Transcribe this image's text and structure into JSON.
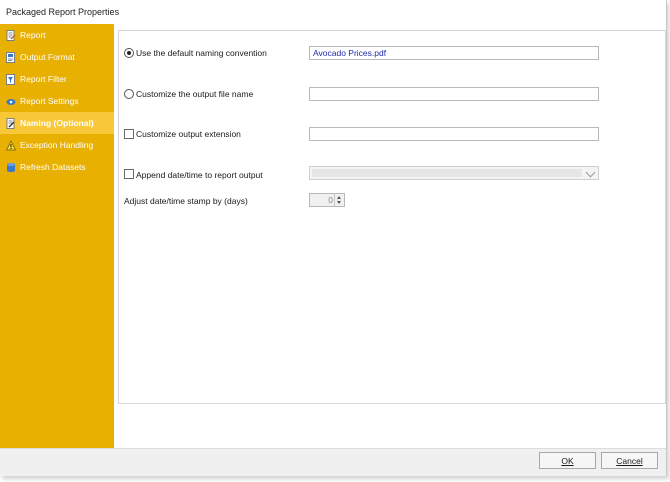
{
  "window": {
    "title": "Packaged Report Properties"
  },
  "sidebar": {
    "items": [
      {
        "label": "Report",
        "icon": "report-icon"
      },
      {
        "label": "Output Format",
        "icon": "output-format-icon"
      },
      {
        "label": "Report Filter",
        "icon": "report-filter-icon"
      },
      {
        "label": "Report Settings",
        "icon": "report-settings-icon"
      },
      {
        "label": "Naming (Optional)",
        "icon": "naming-icon",
        "active": true
      },
      {
        "label": "Exception Handling",
        "icon": "warning-icon"
      },
      {
        "label": "Refresh Datasets",
        "icon": "refresh-datasets-icon"
      }
    ],
    "color": "#e8b000",
    "active_color": "#f8c838"
  },
  "naming": {
    "default_label": "Use the default naming convention",
    "default_value": "Avocado Prices.pdf",
    "customize_name_label": "Customize the output file name",
    "customize_name_value": "",
    "customize_ext_label": "Customize output extension",
    "customize_ext_value": "",
    "append_label": "Append date/time to report output",
    "append_value": "",
    "adjust_label": "Adjust date/time stamp by (days)",
    "adjust_value": "0",
    "selected_option": "default"
  },
  "footer": {
    "ok_label": "OK",
    "cancel_label": "Cancel"
  }
}
